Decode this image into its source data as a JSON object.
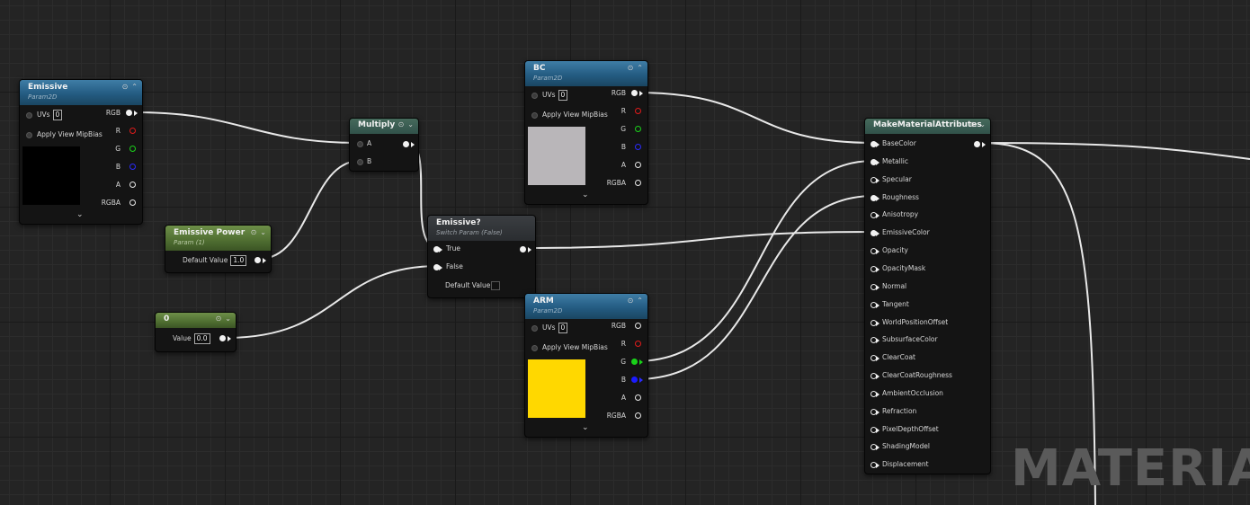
{
  "nodes": {
    "emissive": {
      "title": "Emissive",
      "subtitle": "Param2D",
      "uvs_label": "UVs",
      "uvs_value": "0",
      "mip_label": "Apply View MipBias",
      "outputs": [
        "RGB",
        "R",
        "G",
        "B",
        "A",
        "RGBA"
      ],
      "swatch_color": "#000000"
    },
    "emissive_power": {
      "title": "Emissive Power",
      "subtitle": "Param (1)",
      "default_label": "Default Value",
      "default_value": "1.0"
    },
    "zero": {
      "title": "0",
      "value_label": "Value",
      "value": "0.0"
    },
    "multiply": {
      "title": "Multiply",
      "inputs": [
        "A",
        "B"
      ]
    },
    "switch": {
      "title": "Emissive?",
      "subtitle": "Switch Param (False)",
      "inputs": [
        "True",
        "False"
      ],
      "default_label": "Default Value"
    },
    "bc": {
      "title": "BC",
      "subtitle": "Param2D",
      "uvs_label": "UVs",
      "uvs_value": "0",
      "mip_label": "Apply View MipBias",
      "outputs": [
        "RGB",
        "R",
        "G",
        "B",
        "A",
        "RGBA"
      ],
      "swatch_color": "#b9b6b9"
    },
    "arm": {
      "title": "ARM",
      "subtitle": "Param2D",
      "uvs_label": "UVs",
      "uvs_value": "0",
      "mip_label": "Apply View MipBias",
      "outputs": [
        "RGB",
        "R",
        "G",
        "B",
        "A",
        "RGBA"
      ],
      "swatch_color": "#ffd800"
    },
    "mma": {
      "title": "MakeMaterialAttributes",
      "inputs": [
        "BaseColor",
        "Metallic",
        "Specular",
        "Roughness",
        "Anisotropy",
        "EmissiveColor",
        "Opacity",
        "OpacityMask",
        "Normal",
        "Tangent",
        "WorldPositionOffset",
        "SubsurfaceColor",
        "ClearCoat",
        "ClearCoatRoughness",
        "AmbientOcclusion",
        "Refraction",
        "PixelDepthOffset",
        "ShadingModel",
        "Displacement"
      ]
    }
  },
  "icons": {
    "header": [
      "preview-icon",
      "collapse-icon"
    ],
    "footer": "chevron-down-icon"
  },
  "watermark": "MATERIAL",
  "colors": {
    "wire": "#e8e8e8",
    "texture_header": "#245c82",
    "param_header": "#4f6e31"
  }
}
